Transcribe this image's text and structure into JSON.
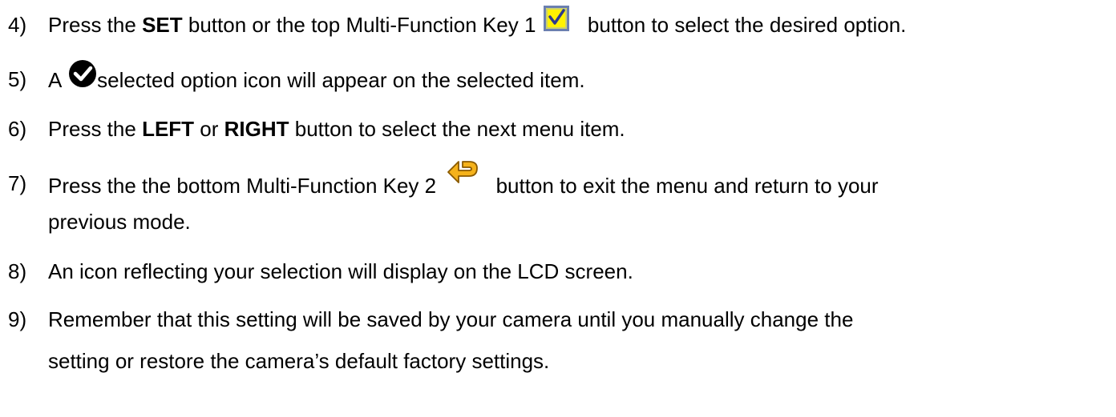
{
  "steps": [
    {
      "num": "4)",
      "pre": "Press the ",
      "bold1": "SET",
      "mid1": " button or the top Multi-Function Key 1 ",
      "post": " button to select the desired option.",
      "icon": "check-box-icon"
    },
    {
      "num": "5)",
      "pre": "A ",
      "post": "selected option icon will appear on the selected item.",
      "icon": "check-circle-icon"
    },
    {
      "num": "6)",
      "pre": "Press the ",
      "bold1": "LEFT",
      "mid1": " or ",
      "bold2": "RIGHT",
      "post": " button to select the next menu item."
    },
    {
      "num": "7)",
      "pre": "Press the the bottom Multi-Function Key 2 ",
      "post": " button to exit the menu and return to your",
      "cont": "previous mode.",
      "icon": "return-arrow-icon"
    },
    {
      "num": "8)",
      "text": "An icon reflecting your selection will display on the LCD screen."
    },
    {
      "num": "9)",
      "text": "Remember that this setting will be saved by your camera until you manually change the",
      "cont": "setting or restore the camera’s default factory settings."
    }
  ],
  "colors": {
    "text": "#000000",
    "checkbox_fill": "#fff200",
    "checkbox_border": "#6b7fb0",
    "check_circle": "#000000",
    "return_arrow": "#f5b21b"
  }
}
